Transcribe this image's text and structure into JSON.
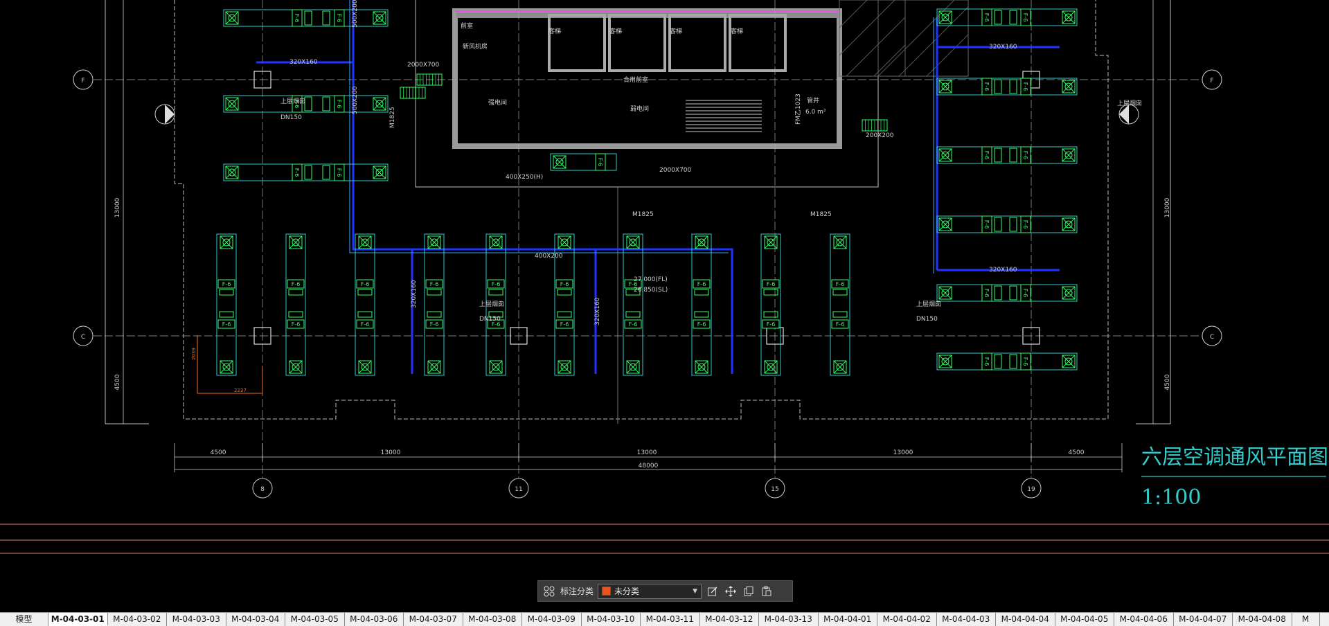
{
  "drawing": {
    "title": "六层空调通风平面图",
    "scale": "1:100",
    "grid_axes": {
      "bottom": [
        "8",
        "11",
        "15",
        "19"
      ],
      "left": [
        "F",
        "C"
      ],
      "right": [
        "F",
        "C"
      ]
    },
    "dimensions": {
      "bottom_segments": [
        "4500",
        "13000",
        "13000",
        "13000",
        "4500"
      ],
      "bottom_total": "48000",
      "vertical_left": [
        "13000",
        "4500"
      ],
      "vertical_right": [
        "13000",
        "4500"
      ],
      "local": [
        "2039",
        "2237"
      ]
    },
    "elevation_fl": "27.000(FL)",
    "elevation_sl": "26.850(SL)",
    "duct_sizes": [
      "320X160",
      "500X200",
      "400X200",
      "320X160",
      "320X160",
      "500X200",
      "320X160",
      "320X160",
      "400X250(H)",
      "200X200",
      "2000X700",
      "2000X700"
    ],
    "equipment_tag": "F-6",
    "room_labels": [
      "客梯",
      "客梯",
      "客梯",
      "客梯",
      "前室",
      "合用前室",
      "新风机房",
      "强电间",
      "弱电间",
      "管井",
      "6.0 m²"
    ],
    "door_tags": [
      "M1825",
      "M1825",
      "M1825",
      "FM乙1023"
    ],
    "annotations": [
      "上层烟囱",
      "DN150",
      "上层烟囱",
      "DN150",
      "上层烟囱",
      "DN150",
      "上层烟囱"
    ]
  },
  "toolbar": {
    "label": "标注分类",
    "selected": "未分类",
    "category_color": "#e8541e"
  },
  "tabs": [
    "模型",
    "M-04-03-01",
    "M-04-03-02",
    "M-04-03-03",
    "M-04-03-04",
    "M-04-03-05",
    "M-04-03-06",
    "M-04-03-07",
    "M-04-03-08",
    "M-04-03-09",
    "M-04-03-10",
    "M-04-03-11",
    "M-04-03-12",
    "M-04-03-13",
    "M-04-04-01",
    "M-04-04-02",
    "M-04-04-03",
    "M-04-04-04",
    "M-04-04-05",
    "M-04-04-06",
    "M-04-04-07",
    "M-04-04-08",
    "M"
  ],
  "active_tab": "M-04-03-01"
}
